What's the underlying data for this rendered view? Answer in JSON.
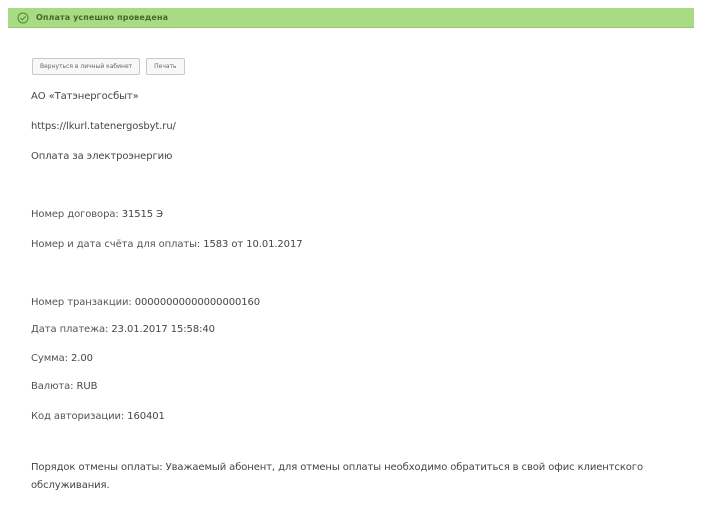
{
  "status": {
    "message": "Оплата успешно проведена",
    "icon": "check-circle-icon",
    "color": "#a9db84"
  },
  "actions": {
    "back_label": "Вернуться в личный кабинет",
    "print_label": "Печать"
  },
  "merchant": {
    "name": "АО «Татэнергосбыт»",
    "url": "https://lkurl.tatenergosbyt.ru/",
    "service": "Оплата за электроэнергию"
  },
  "contract": {
    "number_label": "Номер договора:",
    "number": "31515 Э",
    "invoice_label": "Номер и дата счёта для оплаты:",
    "invoice": "1583 от 10.01.2017"
  },
  "payment": {
    "transaction_label": "Номер транзакции:",
    "transaction": "00000000000000000160",
    "date_label": "Дата платежа:",
    "date": "23.01.2017 15:58:40",
    "sum_label": "Сумма:",
    "sum": "2.00",
    "currency_label": "Валюта:",
    "currency": "RUB",
    "auth_label": "Код авторизации:",
    "auth": "160401"
  },
  "cancel_note": "Порядок отмены оплаты: Уважаемый абонент, для отмены оплаты необходимо обратиться в свой офис клиентского обслуживания."
}
